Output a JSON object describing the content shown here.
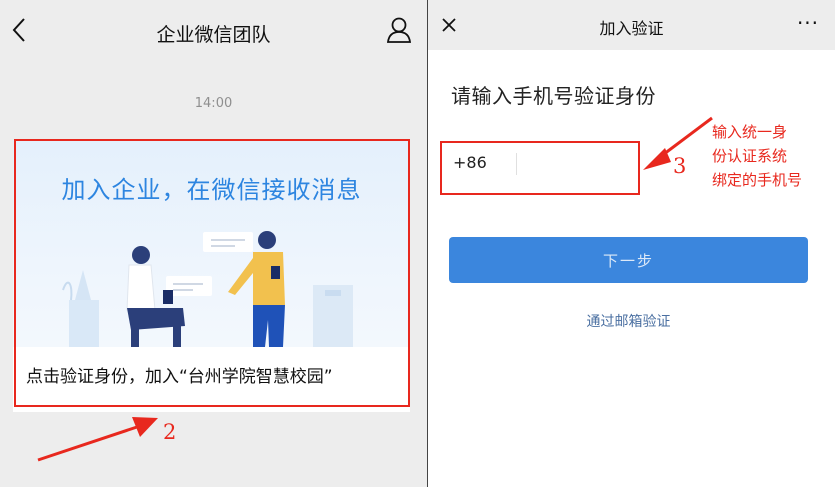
{
  "left": {
    "nav": {
      "back_icon": "chevron-left-icon",
      "title": "企业微信团队",
      "profile_icon": "person-icon"
    },
    "time": "14:00",
    "card": {
      "headline": "加入企业，在微信接收消息",
      "caption": "点击验证身份，加入“台州学院智慧校园”"
    }
  },
  "right": {
    "nav": {
      "close_icon": "close-icon",
      "title": "加入验证",
      "more_label": "···"
    },
    "heading": "请输入手机号验证身份",
    "country_code": "+86",
    "phone_value": "",
    "next_label": "下一步",
    "email_link": "通过邮箱验证"
  },
  "annotations": {
    "label_2": "2",
    "label_3": "3",
    "note_lines": [
      "输入统一身",
      "份认证系统",
      "绑定的手机号"
    ]
  },
  "colors": {
    "accent_blue": "#3b86dd",
    "annotation_red": "#e8281e",
    "headline_blue": "#2d85e0"
  }
}
